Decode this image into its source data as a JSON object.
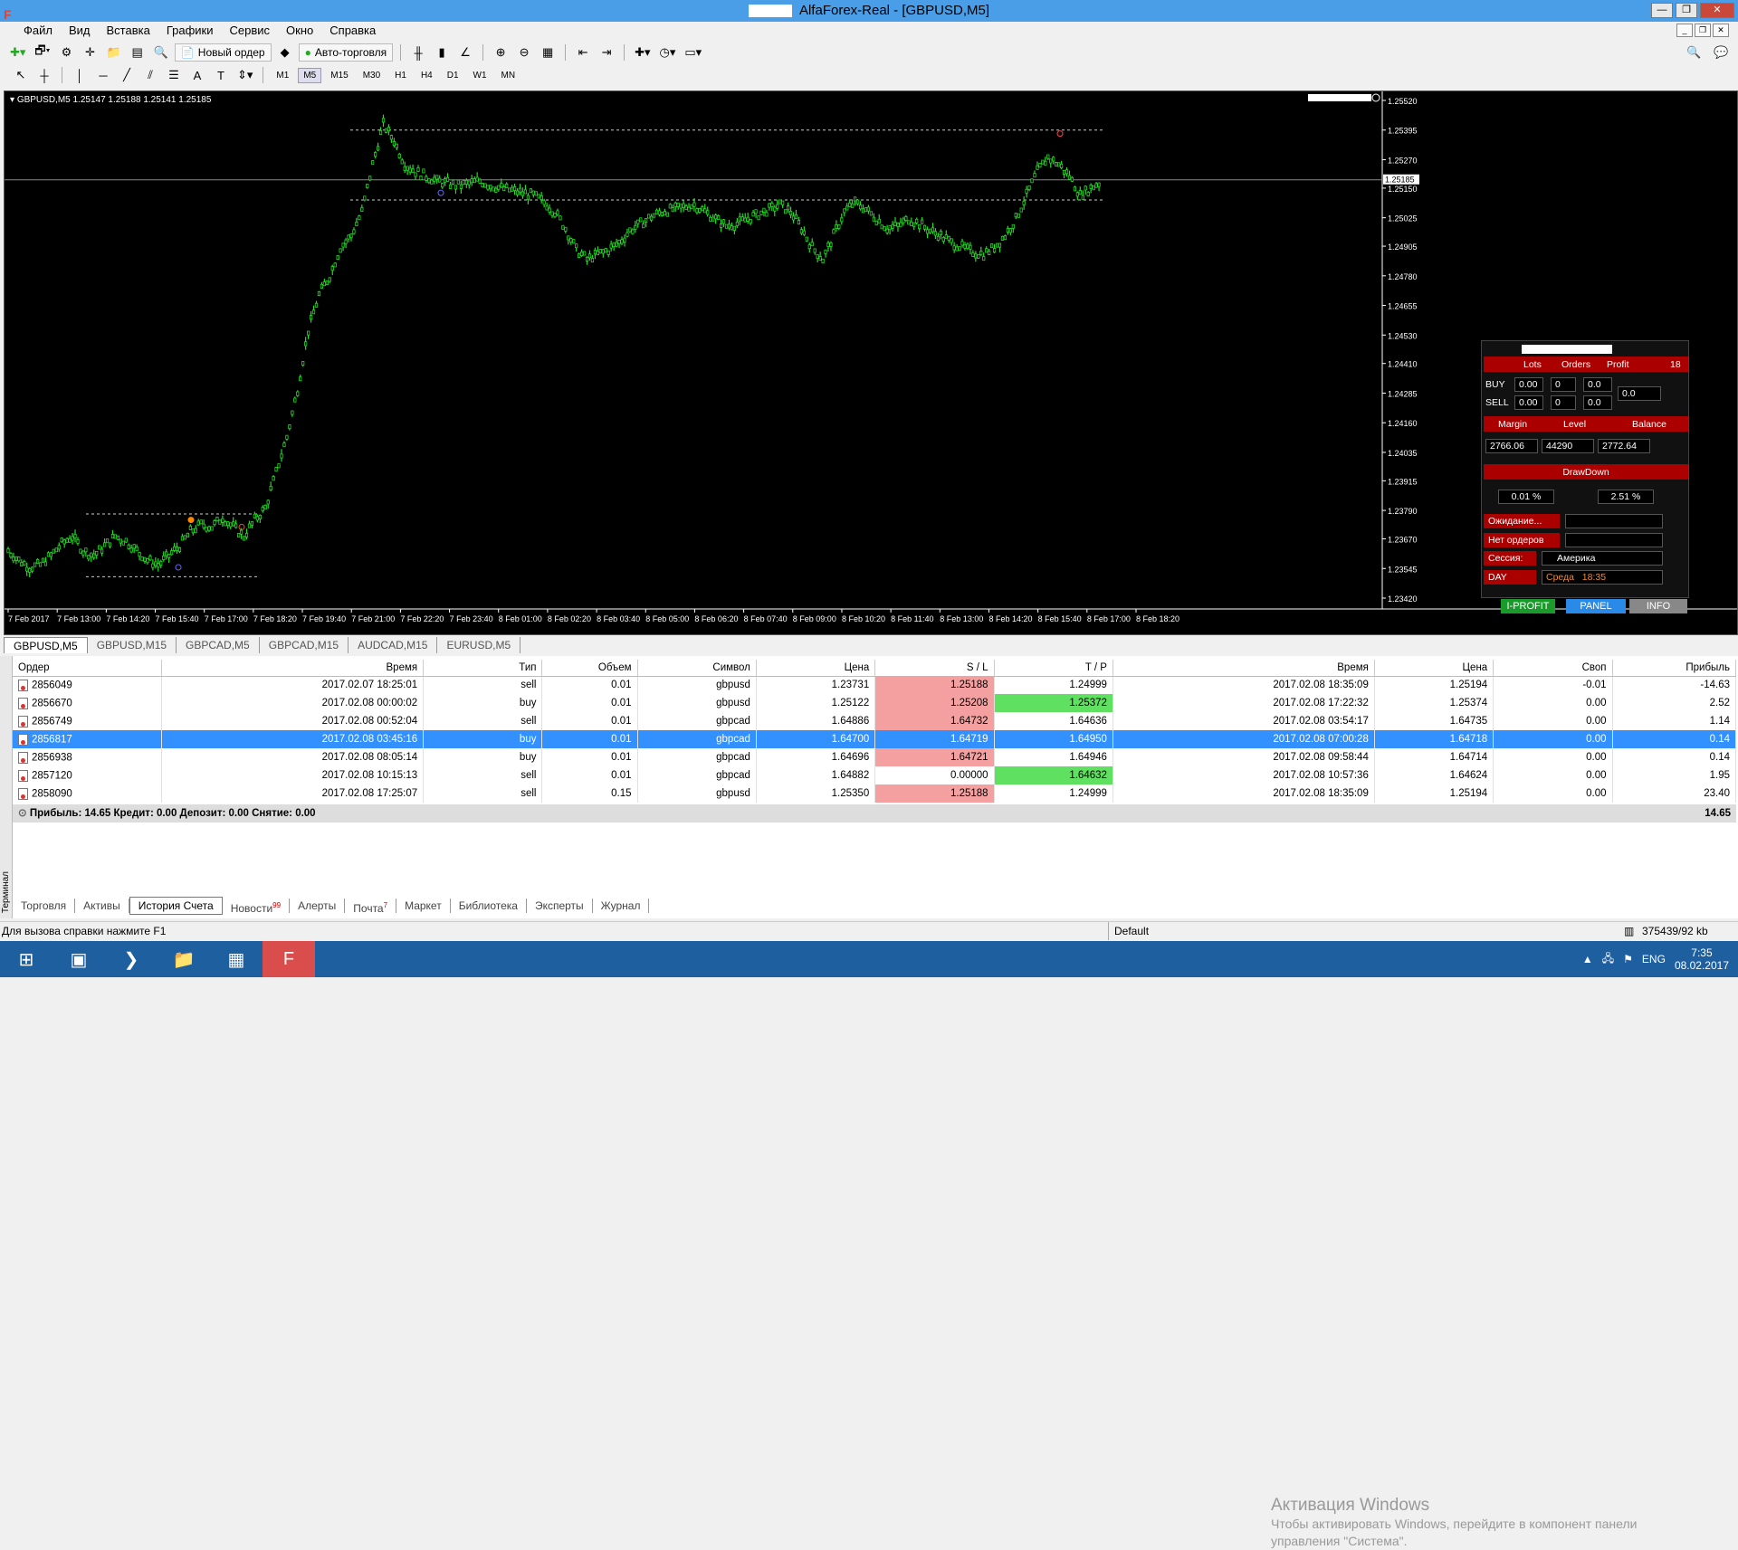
{
  "window": {
    "title": "AlfaForex-Real - [GBPUSD,M5]"
  },
  "menu": [
    "Файл",
    "Вид",
    "Вставка",
    "Графики",
    "Сервис",
    "Окно",
    "Справка"
  ],
  "toolbar": {
    "new_order": "Новый ордер",
    "auto_trading": "Авто-торговля"
  },
  "timeframes": [
    "M1",
    "M5",
    "M15",
    "M30",
    "H1",
    "H4",
    "D1",
    "W1",
    "MN"
  ],
  "active_timeframe": "M5",
  "chart": {
    "info": "GBPUSD,M5  1.25147 1.25188 1.25141 1.25185",
    "current_price_label": "1.25185",
    "colors": {
      "background": "#000000",
      "candles": "#22dd22",
      "grid": "#ffffff"
    }
  },
  "chart_data": {
    "type": "line",
    "title": "GBPUSD,M5",
    "x_labels": [
      "7 Feb 2017",
      "7 Feb 13:00",
      "7 Feb 14:20",
      "7 Feb 15:40",
      "7 Feb 17:00",
      "7 Feb 18:20",
      "7 Feb 19:40",
      "7 Feb 21:00",
      "7 Feb 22:20",
      "7 Feb 23:40",
      "8 Feb 01:00",
      "8 Feb 02:20",
      "8 Feb 03:40",
      "8 Feb 05:00",
      "8 Feb 06:20",
      "8 Feb 07:40",
      "8 Feb 09:00",
      "8 Feb 10:20",
      "8 Feb 11:40",
      "8 Feb 13:00",
      "8 Feb 14:20",
      "8 Feb 15:40",
      "8 Feb 17:00",
      "8 Feb 18:20"
    ],
    "y_ticks": [
      "1.25520",
      "1.25395",
      "1.25270",
      "1.25150",
      "1.25025",
      "1.24905",
      "1.24780",
      "1.24655",
      "1.24530",
      "1.24410",
      "1.24285",
      "1.24160",
      "1.24035",
      "1.23915",
      "1.23790",
      "1.23670",
      "1.23545",
      "1.23420"
    ],
    "ylim": [
      1.2342,
      1.2552
    ],
    "price_path": [
      1.2362,
      1.2358,
      1.2355,
      1.2356,
      1.236,
      1.2365,
      1.2368,
      1.2362,
      1.236,
      1.2364,
      1.2368,
      1.2366,
      1.2362,
      1.2358,
      1.2356,
      1.236,
      1.2364,
      1.237,
      1.2373,
      1.2372,
      1.2376,
      1.2372,
      1.2368,
      1.2375,
      1.238,
      1.2395,
      1.241,
      1.243,
      1.2455,
      1.247,
      1.2478,
      1.249,
      1.2495,
      1.2505,
      1.2525,
      1.2542,
      1.2535,
      1.2525,
      1.2522,
      1.252,
      1.2518,
      1.2517,
      1.2516,
      1.2517,
      1.2518,
      1.2516,
      1.2515,
      1.2514,
      1.2513,
      1.2512,
      1.2509,
      1.2505,
      1.2498,
      1.2489,
      1.2485,
      1.2487,
      1.2489,
      1.2492,
      1.2497,
      1.25,
      1.2503,
      1.2505,
      1.2506,
      1.2507,
      1.2508,
      1.2505,
      1.2502,
      1.2499,
      1.25,
      1.2502,
      1.2504,
      1.2506,
      1.2508,
      1.2505,
      1.2498,
      1.249,
      1.2485,
      1.2495,
      1.2505,
      1.2509,
      1.2506,
      1.2502,
      1.2498,
      1.2499,
      1.2502,
      1.25,
      1.2497,
      1.2495,
      1.2492,
      1.249,
      1.2488,
      1.2487,
      1.249,
      1.2495,
      1.2502,
      1.2512,
      1.2522,
      1.2528,
      1.2525,
      1.252,
      1.2512,
      1.2515,
      1.2518
    ],
    "levels": [
      1.25395,
      1.251,
      1.23775,
      1.2351
    ],
    "series": [
      {
        "values": [
          1.2362,
          1.2358,
          1.2355,
          1.2356,
          1.236,
          1.2365,
          1.2368,
          1.2362,
          1.236,
          1.2364,
          1.2368,
          1.2366,
          1.2362,
          1.2358,
          1.2356,
          1.236,
          1.2364,
          1.237,
          1.2373,
          1.2372,
          1.2376,
          1.2372,
          1.2368,
          1.2375,
          1.238,
          1.2395,
          1.241,
          1.243,
          1.2455,
          1.247,
          1.2478,
          1.249,
          1.2495,
          1.2505,
          1.2525,
          1.2542,
          1.2535,
          1.2525,
          1.2522,
          1.252,
          1.2518,
          1.2517,
          1.2516,
          1.2517,
          1.2518,
          1.2516,
          1.2515,
          1.2514,
          1.2513,
          1.2512,
          1.2509,
          1.2505,
          1.2498,
          1.2489,
          1.2485,
          1.2487,
          1.2489,
          1.2492,
          1.2497,
          1.25,
          1.2503,
          1.2505,
          1.2506,
          1.2507,
          1.2508,
          1.2505,
          1.2502,
          1.2499,
          1.25,
          1.2502,
          1.2504,
          1.2506,
          1.2508,
          1.2505,
          1.2498,
          1.249,
          1.2485,
          1.2495,
          1.2505,
          1.2509,
          1.2506,
          1.2502,
          1.2498,
          1.2499,
          1.2502,
          1.25,
          1.2497,
          1.2495,
          1.2492,
          1.249,
          1.2488,
          1.2487,
          1.249,
          1.2495,
          1.2502,
          1.2512,
          1.2522,
          1.2528,
          1.2525,
          1.252,
          1.2512,
          1.2515,
          1.2518
        ]
      }
    ]
  },
  "panel": {
    "headers": [
      "Lots",
      "Orders",
      "Profit"
    ],
    "count": "18",
    "buy": {
      "label": "BUY",
      "lots": "0.00",
      "orders": "0",
      "profit": "0.0"
    },
    "sell": {
      "label": "SELL",
      "lots": "0.00",
      "orders": "0",
      "profit": "0.0"
    },
    "total_profit": "0.0",
    "margin_headers": [
      "Margin",
      "Level",
      "Balance"
    ],
    "margin": "2766.06",
    "level": "44290",
    "balance": "2772.64",
    "drawdown_label": "DrawDown",
    "drawdown_1": "0.01 %",
    "drawdown_2": "2.51 %",
    "status_rows": [
      {
        "label": "Ожидание...",
        "value": ""
      },
      {
        "label": "Нет ордеров",
        "value": ""
      },
      {
        "label": "Сессия:",
        "value": "Америка"
      },
      {
        "label": "DAY",
        "value": "Среда",
        "time": "18:35"
      }
    ],
    "buttons": {
      "iprofit": "I-PROFIT",
      "panel": "PANEL",
      "info": "INFO"
    }
  },
  "chart_tabs": [
    "GBPUSD,M5",
    "GBPUSD,M15",
    "GBPCAD,M5",
    "GBPCAD,M15",
    "AUDCAD,M15",
    "EURUSD,M5"
  ],
  "history": {
    "columns": [
      "Ордер",
      "Время",
      "Тип",
      "Объем",
      "Символ",
      "Цена",
      "S / L",
      "T / P",
      "Время",
      "Цена",
      "Своп",
      "Прибыль"
    ],
    "rows": [
      {
        "order": "2856049",
        "open_time": "2017.02.07 18:25:01",
        "type": "sell",
        "volume": "0.01",
        "symbol": "gbpusd",
        "open_price": "1.23731",
        "sl": "1.25188",
        "tp": "1.24999",
        "close_time": "2017.02.08 18:35:09",
        "close_price": "1.25194",
        "swap": "-0.01",
        "profit": "-14.63"
      },
      {
        "order": "2856670",
        "open_time": "2017.02.08 00:00:02",
        "type": "buy",
        "volume": "0.01",
        "symbol": "gbpusd",
        "open_price": "1.25122",
        "sl": "1.25208",
        "tp": "1.25372",
        "close_time": "2017.02.08 17:22:32",
        "close_price": "1.25374",
        "swap": "0.00",
        "profit": "2.52"
      },
      {
        "order": "2856749",
        "open_time": "2017.02.08 00:52:04",
        "type": "sell",
        "volume": "0.01",
        "symbol": "gbpcad",
        "open_price": "1.64886",
        "sl": "1.64732",
        "tp": "1.64636",
        "close_time": "2017.02.08 03:54:17",
        "close_price": "1.64735",
        "swap": "0.00",
        "profit": "1.14"
      },
      {
        "order": "2856817",
        "open_time": "2017.02.08 03:45:16",
        "type": "buy",
        "volume": "0.01",
        "symbol": "gbpcad",
        "open_price": "1.64700",
        "sl": "1.64719",
        "tp": "1.64950",
        "close_time": "2017.02.08 07:00:28",
        "close_price": "1.64718",
        "swap": "0.00",
        "profit": "0.14"
      },
      {
        "order": "2856938",
        "open_time": "2017.02.08 08:05:14",
        "type": "buy",
        "volume": "0.01",
        "symbol": "gbpcad",
        "open_price": "1.64696",
        "sl": "1.64721",
        "tp": "1.64946",
        "close_time": "2017.02.08 09:58:44",
        "close_price": "1.64714",
        "swap": "0.00",
        "profit": "0.14"
      },
      {
        "order": "2857120",
        "open_time": "2017.02.08 10:15:13",
        "type": "sell",
        "volume": "0.01",
        "symbol": "gbpcad",
        "open_price": "1.64882",
        "sl": "0.00000",
        "tp": "1.64632",
        "close_time": "2017.02.08 10:57:36",
        "close_price": "1.64624",
        "swap": "0.00",
        "profit": "1.95"
      },
      {
        "order": "2858090",
        "open_time": "2017.02.08 17:25:07",
        "type": "sell",
        "volume": "0.15",
        "symbol": "gbpusd",
        "open_price": "1.25350",
        "sl": "1.25188",
        "tp": "1.24999",
        "close_time": "2017.02.08 18:35:09",
        "close_price": "1.25194",
        "swap": "0.00",
        "profit": "23.40"
      }
    ],
    "summary": "Прибыль: 14.65  Кредит: 0.00  Депозит: 0.00  Снятие: 0.00",
    "summary_total": "14.65"
  },
  "windows_activation": {
    "heading": "Активация Windows",
    "line1": "Чтобы активировать Windows, перейдите в компонент панели",
    "line2": "управления \"Система\"."
  },
  "terminal": {
    "side_label": "Терминал",
    "tabs": [
      {
        "label": "Торговля"
      },
      {
        "label": "Активы"
      },
      {
        "label": "История Счета"
      },
      {
        "label": "Новости",
        "badge": "99"
      },
      {
        "label": "Алерты"
      },
      {
        "label": "Почта",
        "badge": "7"
      },
      {
        "label": "Маркет"
      },
      {
        "label": "Библиотека"
      },
      {
        "label": "Эксперты"
      },
      {
        "label": "Журнал"
      }
    ],
    "active_tab": "История Счета"
  },
  "status": {
    "help": "Для вызова справки нажмите F1",
    "profile": "Default",
    "traffic": "375439/92 kb"
  },
  "tray": {
    "lang": "ENG",
    "time": "7:35",
    "date": "08.02.2017"
  }
}
